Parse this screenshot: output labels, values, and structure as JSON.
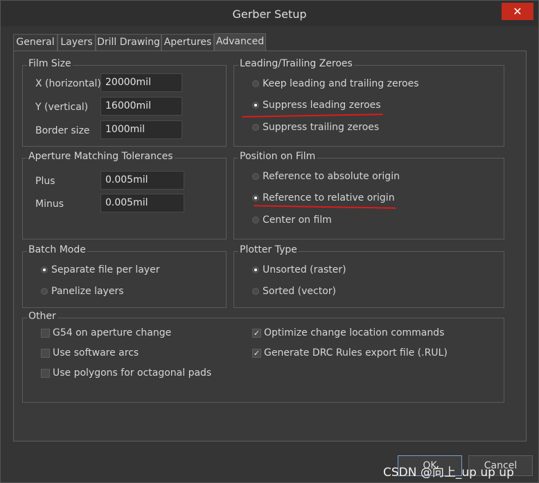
{
  "window": {
    "title": "Gerber Setup",
    "close_glyph": "✕"
  },
  "tabs": [
    "General",
    "Layers",
    "Drill Drawing",
    "Apertures",
    "Advanced"
  ],
  "film_size": {
    "title": "Film Size",
    "x_label": "X (horizontal)",
    "x_value": "20000mil",
    "y_label": "Y (vertical)",
    "y_value": "16000mil",
    "border_label": "Border size",
    "border_value": "1000mil"
  },
  "leading_trailing": {
    "title": "Leading/Trailing Zeroes",
    "options": [
      "Keep leading and trailing zeroes",
      "Suppress leading zeroes",
      "Suppress trailing zeroes"
    ],
    "selected": "Suppress leading zeroes"
  },
  "aperture_tol": {
    "title": "Aperture Matching Tolerances",
    "plus_label": "Plus",
    "plus_value": "0.005mil",
    "minus_label": "Minus",
    "minus_value": "0.005mil"
  },
  "position_film": {
    "title": "Position on Film",
    "options": [
      "Reference to absolute origin",
      "Reference to relative origin",
      "Center on film"
    ],
    "selected": "Reference to relative origin"
  },
  "batch_mode": {
    "title": "Batch Mode",
    "options": [
      "Separate file per layer",
      "Panelize layers"
    ],
    "selected": "Separate file per layer"
  },
  "plotter_type": {
    "title": "Plotter Type",
    "options": [
      "Unsorted (raster)",
      "Sorted (vector)"
    ],
    "selected": "Unsorted (raster)"
  },
  "other": {
    "title": "Other",
    "g54": {
      "label": "G54 on aperture change",
      "checked": false
    },
    "software_arcs": {
      "label": "Use software arcs",
      "checked": false
    },
    "polygons": {
      "label": "Use polygons for octagonal pads",
      "checked": false
    },
    "optimize": {
      "label": "Optimize change location commands",
      "checked": true
    },
    "drc": {
      "label": "Generate DRC Rules export file (.RUL)",
      "checked": true
    }
  },
  "buttons": {
    "ok": "OK",
    "cancel": "Cancel"
  },
  "watermark": "CSDN @向上_up up up",
  "colors": {
    "annotation_red": "#e01b1b",
    "close_red": "#c42b1c"
  }
}
